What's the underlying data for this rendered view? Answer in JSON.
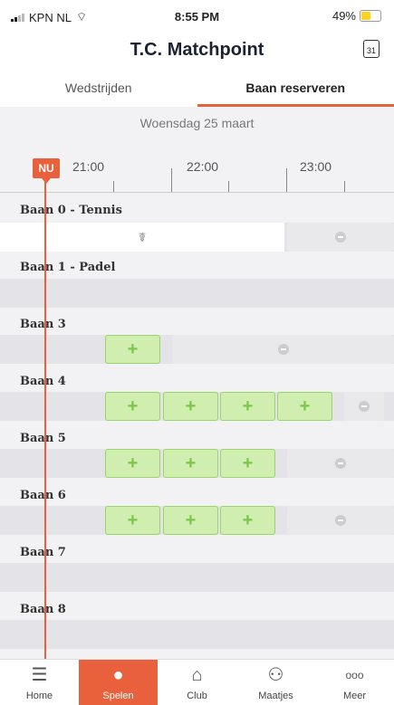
{
  "status": {
    "carrier": "KPN NL",
    "time": "8:55 PM",
    "battery": "49%"
  },
  "header": {
    "title": "T.C. Matchpoint",
    "calendar_day": "31"
  },
  "tabs": [
    {
      "label": "Wedstrijden"
    },
    {
      "label": "Baan reserveren"
    }
  ],
  "date_label": "Woensdag 25 maart",
  "now_label": "NU",
  "times": [
    "21:00",
    "22:00",
    "23:00"
  ],
  "courts": [
    {
      "name": "Baan 0 - Tennis"
    },
    {
      "name": "Baan 1 - Padel"
    },
    {
      "name": "Baan 3"
    },
    {
      "name": "Baan 4"
    },
    {
      "name": "Baan 5"
    },
    {
      "name": "Baan 6"
    },
    {
      "name": "Baan 7"
    },
    {
      "name": "Baan 8"
    }
  ],
  "plus": "+",
  "trophy": "☤",
  "nav": [
    {
      "label": "Home",
      "icon": "menu-icon"
    },
    {
      "label": "Spelen",
      "icon": "tennis-ball-icon"
    },
    {
      "label": "Club",
      "icon": "clubhouse-icon"
    },
    {
      "label": "Maatjes",
      "icon": "people-icon"
    },
    {
      "label": "Meer",
      "icon": "more-icon"
    }
  ],
  "colors": {
    "accent": "#e8603c",
    "free": "#cfeeb0",
    "busy": "#e9e9ec"
  }
}
